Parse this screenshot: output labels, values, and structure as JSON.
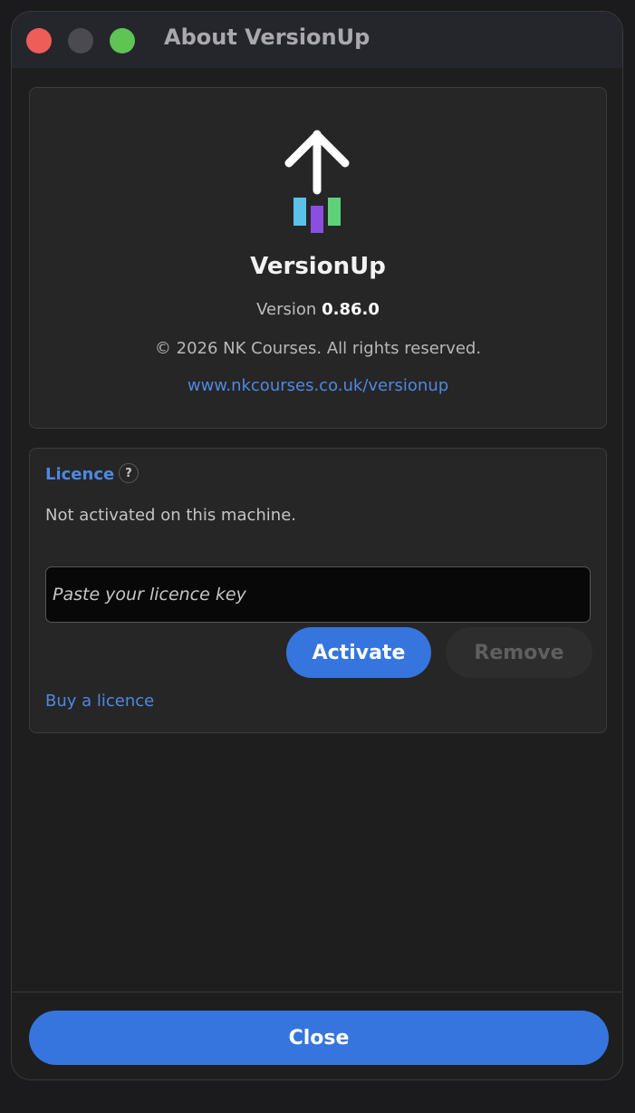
{
  "window": {
    "title": "About VersionUp"
  },
  "about": {
    "app_name": "VersionUp",
    "version_label": "Version",
    "version_number": "0.86.0",
    "copyright": "© 2026 NK Courses. All rights reserved.",
    "website": "www.nkcourses.co.uk/versionup",
    "logo_colors": {
      "arrow": "#ffffff",
      "bar_left": "#5bc0ea",
      "bar_middle": "#8a4fe0",
      "bar_right": "#5fd17a"
    }
  },
  "licence": {
    "title": "Licence",
    "help_icon": "?",
    "status": "Not activated on this machine.",
    "key_placeholder": "Paste your licence key",
    "activate_label": "Activate",
    "remove_label": "Remove",
    "buy_link": "Buy a licence"
  },
  "footer": {
    "close_label": "Close"
  },
  "colors": {
    "accent": "#3575dd",
    "link": "#4f88e3",
    "close_traffic": "#ee5d57",
    "zoom_traffic": "#5fc454"
  }
}
